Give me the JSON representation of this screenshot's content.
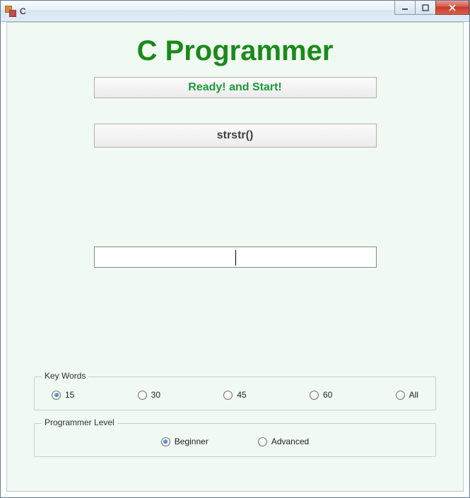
{
  "window": {
    "title": "C"
  },
  "app": {
    "title": "C Programmer",
    "status": "Ready! and Start!",
    "keyword": "strstr()",
    "input_value": ""
  },
  "keywords_group": {
    "legend": "Key Words",
    "options": [
      {
        "label": "15",
        "checked": true
      },
      {
        "label": "30",
        "checked": false
      },
      {
        "label": "45",
        "checked": false
      },
      {
        "label": "60",
        "checked": false
      },
      {
        "label": "All",
        "checked": false
      }
    ]
  },
  "level_group": {
    "legend": "Programmer Level",
    "options": [
      {
        "label": "Beginner",
        "checked": true
      },
      {
        "label": "Advanced",
        "checked": false
      }
    ]
  }
}
